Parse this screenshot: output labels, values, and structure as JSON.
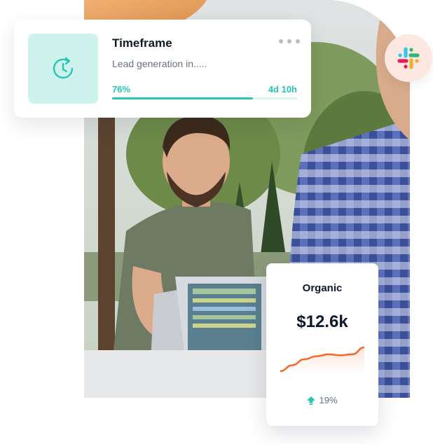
{
  "timeframe": {
    "title": "Timeframe",
    "subtitle": "Lead generation in.....",
    "percent_label": "76%",
    "progress": 0.76,
    "remaining": "4d 10h",
    "icon": "clock-refresh-icon",
    "more_icon": "more-dots-icon"
  },
  "slack": {
    "icon": "slack-logo-icon"
  },
  "organic": {
    "title": "Organic",
    "value": "$12.6k",
    "change": "19%",
    "change_icon": "arrow-up-icon",
    "trend": [
      4,
      10,
      16,
      19,
      21,
      20,
      21,
      28
    ]
  },
  "colors": {
    "accent": "#25c7b2",
    "accent_light": "#cdf3ec",
    "chart_line": "#f26a2e",
    "slack_badge_bg": "#fde7e1"
  }
}
